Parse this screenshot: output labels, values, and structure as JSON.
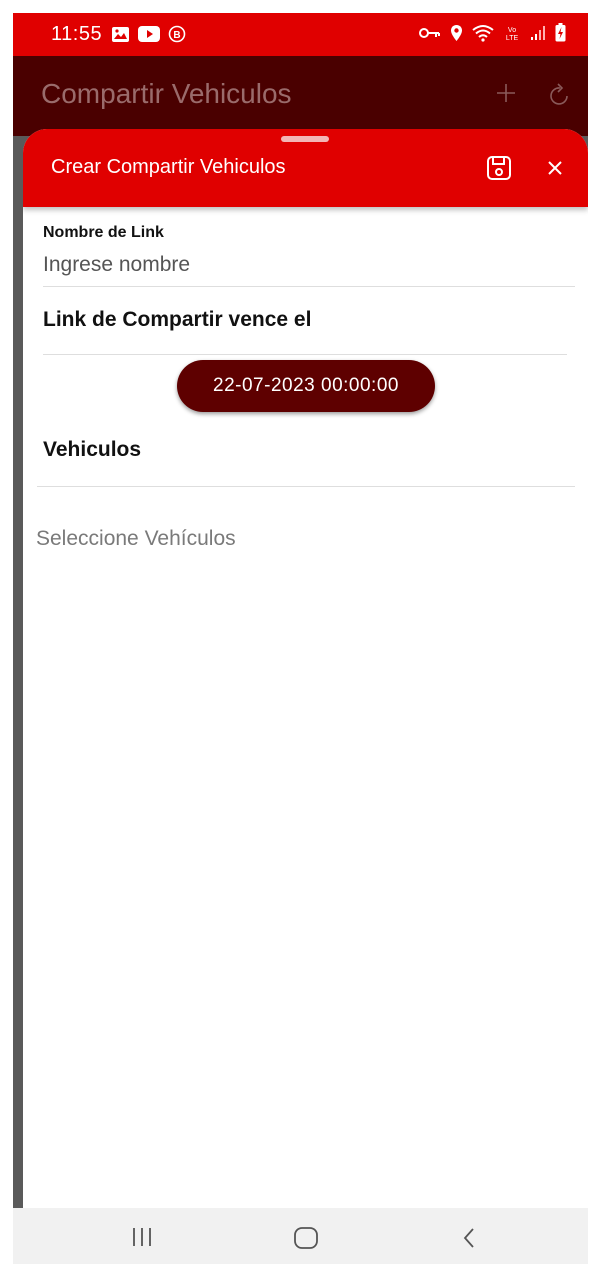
{
  "status_bar": {
    "time": "11:55",
    "left_icons": [
      "gallery-icon",
      "youtube-icon",
      "b-badge-icon"
    ],
    "right_icons": [
      "vpn-key-icon",
      "location-icon",
      "wifi-icon",
      "volte-lte-icon",
      "signal-icon",
      "battery-charging-icon"
    ],
    "lte_label": "LTE"
  },
  "app_bar": {
    "title": "Compartir Vehiculos"
  },
  "sheet": {
    "title": "Crear Compartir Vehiculos",
    "name_field": {
      "label": "Nombre de Link",
      "placeholder": "Ingrese nombre",
      "value": ""
    },
    "expiry_section_title": "Link de Compartir vence el",
    "expiry_datetime": "22-07-2023 00:00:00",
    "vehicles_section_title": "Vehiculos",
    "vehicles_placeholder": "Seleccione Vehículos"
  },
  "colors": {
    "primary_red": "#e00000",
    "dark_red": "#4a0000",
    "pill_red": "#5e0000"
  }
}
